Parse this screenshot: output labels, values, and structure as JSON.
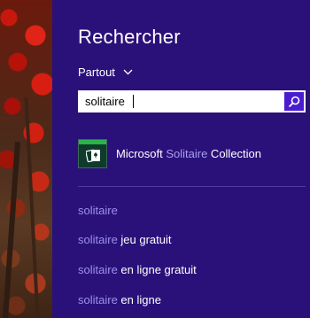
{
  "panel": {
    "title": "Rechercher",
    "scope_label": "Partout",
    "search": {
      "value": "solitaire",
      "placeholder": ""
    }
  },
  "results": {
    "apps": [
      {
        "prefix": "Microsoft ",
        "match": "Solitaire",
        "suffix": " Collection"
      }
    ],
    "suggestions": [
      {
        "match": "solitaire",
        "rest": ""
      },
      {
        "match": "solitaire",
        "rest": " jeu gratuit"
      },
      {
        "match": "solitaire",
        "rest": " en ligne gratuit"
      },
      {
        "match": "solitaire",
        "rest": " en ligne"
      }
    ]
  },
  "colors": {
    "panel_bg": "#2a117a",
    "search_button": "#4a1bd0",
    "highlight_text": "#a99ef0"
  },
  "icons": {
    "scope": "chevron-down-icon",
    "search": "search-icon",
    "app": "solitaire-app-icon"
  }
}
